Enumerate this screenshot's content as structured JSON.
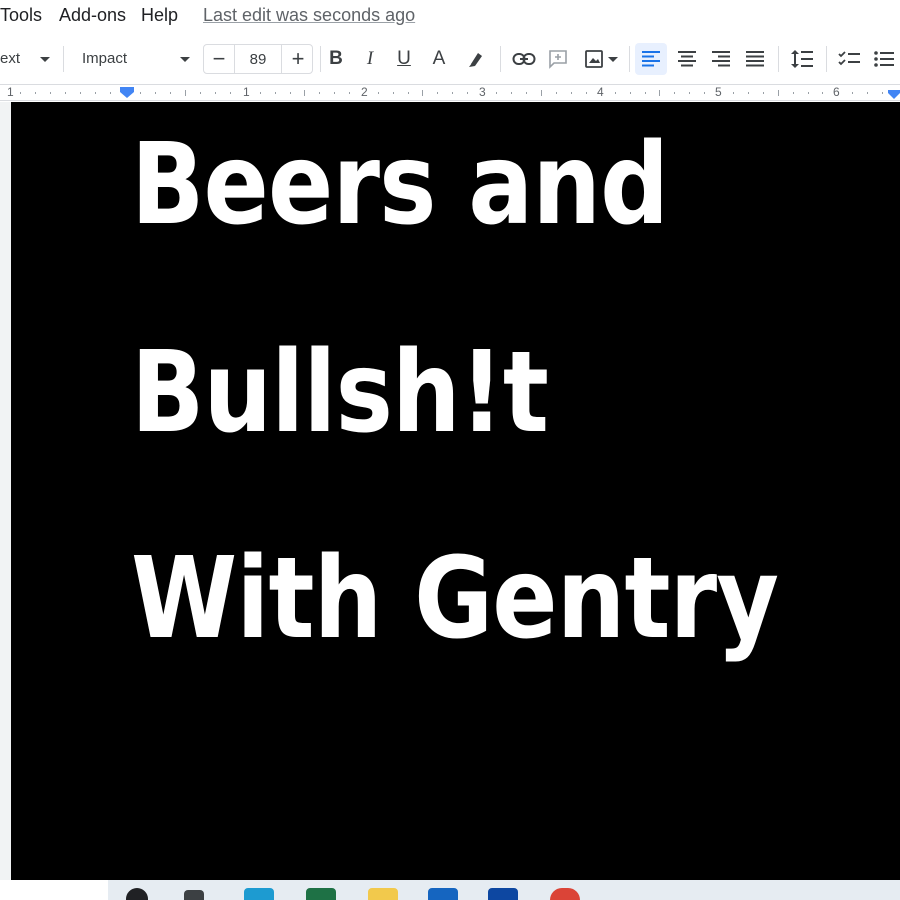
{
  "menu": {
    "items": [
      "Tools",
      "Add-ons",
      "Help"
    ],
    "last_edit": "Last edit was seconds ago"
  },
  "toolbar": {
    "style_partial": "ext",
    "font_name": "Impact",
    "font_size": "89",
    "minus": "−",
    "plus": "+",
    "bold": "B",
    "italic": "I",
    "underline": "U",
    "text_color": "A"
  },
  "ruler": {
    "numbers": [
      "1",
      "1",
      "2",
      "3",
      "4",
      "5",
      "6"
    ]
  },
  "document": {
    "lines": [
      "Beers and",
      "Bullsh!t",
      "With Gentry"
    ]
  },
  "colors": {
    "accent": "#1a73e8",
    "page_background": "#000000",
    "text": "#ffffff"
  },
  "icons": {
    "taskbar": [
      "search-icon",
      "task-view-icon",
      "edge-icon",
      "excel-icon",
      "file-explorer-icon",
      "store-icon",
      "onedrive-icon",
      "chrome-icon"
    ]
  }
}
